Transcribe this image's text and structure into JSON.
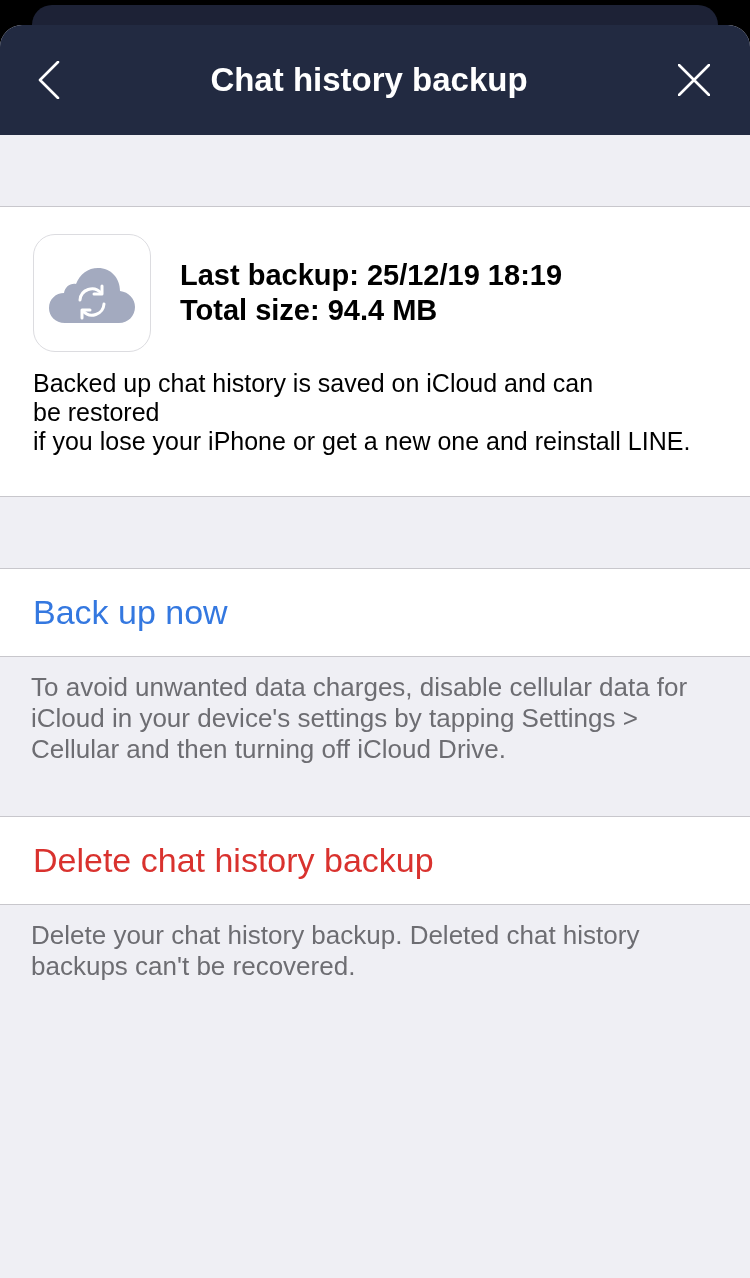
{
  "header": {
    "title": "Chat history backup"
  },
  "backup_info": {
    "last_backup": "Last backup: 25/12/19 18:19",
    "total_size": "Total size: 94.4 MB",
    "description": "Backed up chat history is saved on iCloud and can\nbe restored\nif you lose your iPhone or get a new one and reinstall LINE."
  },
  "actions": [
    {
      "kind": "action",
      "label": "Back up now",
      "footer": "To avoid unwanted data charges, disable cellular data for iCloud in your device's settings by tapping Settings > Cellular and then turning off iCloud Drive."
    },
    {
      "kind": "destructive",
      "label": "Delete chat history backup",
      "footer": "Delete your chat history backup. Deleted chat history backups can't be recovered."
    }
  ]
}
